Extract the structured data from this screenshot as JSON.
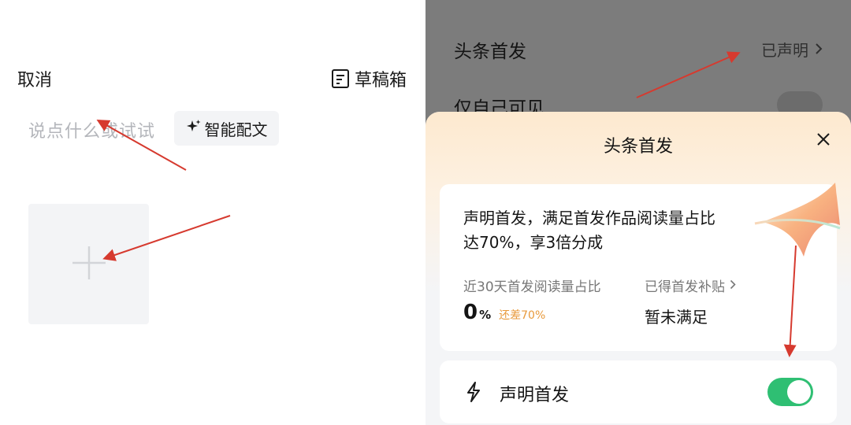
{
  "compose": {
    "cancel_label": "取消",
    "drafts_label": "草稿箱",
    "placeholder": "说点什么或试试",
    "smart_button_label": "智能配文",
    "add_icon": "plus-icon"
  },
  "settings": {
    "first_publish_label": "头条首发",
    "first_publish_value": "已声明",
    "private_label": "仅自己可见"
  },
  "sheet": {
    "title": "头条首发",
    "headline_line1": "声明首发，满足首发作品阅读量占比",
    "headline_line2": "达70%，享3倍分成",
    "stat_label": "近30天首发阅读量占比",
    "stat_value": "0",
    "stat_unit": "%",
    "stat_diff": "还差70%",
    "subsidy_label": "已得首发补贴",
    "subsidy_value": "暂未满足",
    "declare_label": "声明首发",
    "declare_enabled": true
  },
  "colors": {
    "toggle_on": "#2fbf73",
    "diff_text": "#e89a3c",
    "annotation_arrow": "#d63a2f"
  }
}
